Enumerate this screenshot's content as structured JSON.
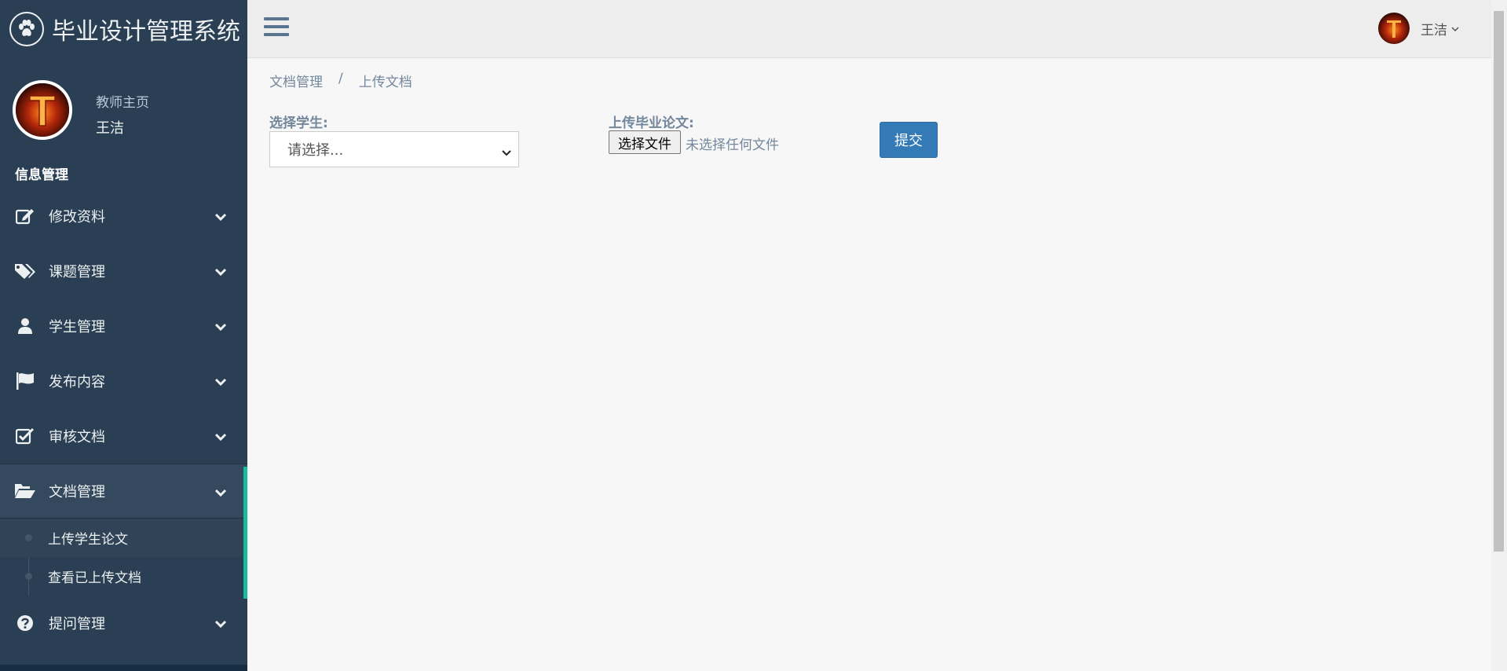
{
  "app": {
    "title": "毕业设计管理系统"
  },
  "profile": {
    "role": "教师主页",
    "name": "王洁"
  },
  "sidebar": {
    "section_title": "信息管理",
    "items": [
      {
        "label": "修改资料",
        "icon": "edit-icon"
      },
      {
        "label": "课题管理",
        "icon": "tags-icon"
      },
      {
        "label": "学生管理",
        "icon": "user-icon"
      },
      {
        "label": "发布内容",
        "icon": "flag-icon"
      },
      {
        "label": "审核文档",
        "icon": "check-square-icon"
      },
      {
        "label": "文档管理",
        "icon": "folder-open-icon",
        "expanded": true
      },
      {
        "label": "提问管理",
        "icon": "question-circle-icon"
      }
    ],
    "submenu": [
      {
        "label": "上传学生论文",
        "current": true
      },
      {
        "label": "查看已上传文档",
        "current": false
      }
    ],
    "active_accent": "#1abb9c"
  },
  "topbar": {
    "user_name": "王洁"
  },
  "breadcrumb": {
    "items": [
      "文档管理",
      "上传文档"
    ],
    "separator": "/"
  },
  "form": {
    "student_label": "选择学生:",
    "student_select_value": "请选择...",
    "upload_label": "上传毕业论文:",
    "file_button": "选择文件",
    "file_status": "未选择任何文件",
    "submit_label": "提交"
  },
  "colors": {
    "sidebar_bg": "#2a3f54",
    "primary_button": "#337ab7",
    "label_text": "#73879c"
  }
}
